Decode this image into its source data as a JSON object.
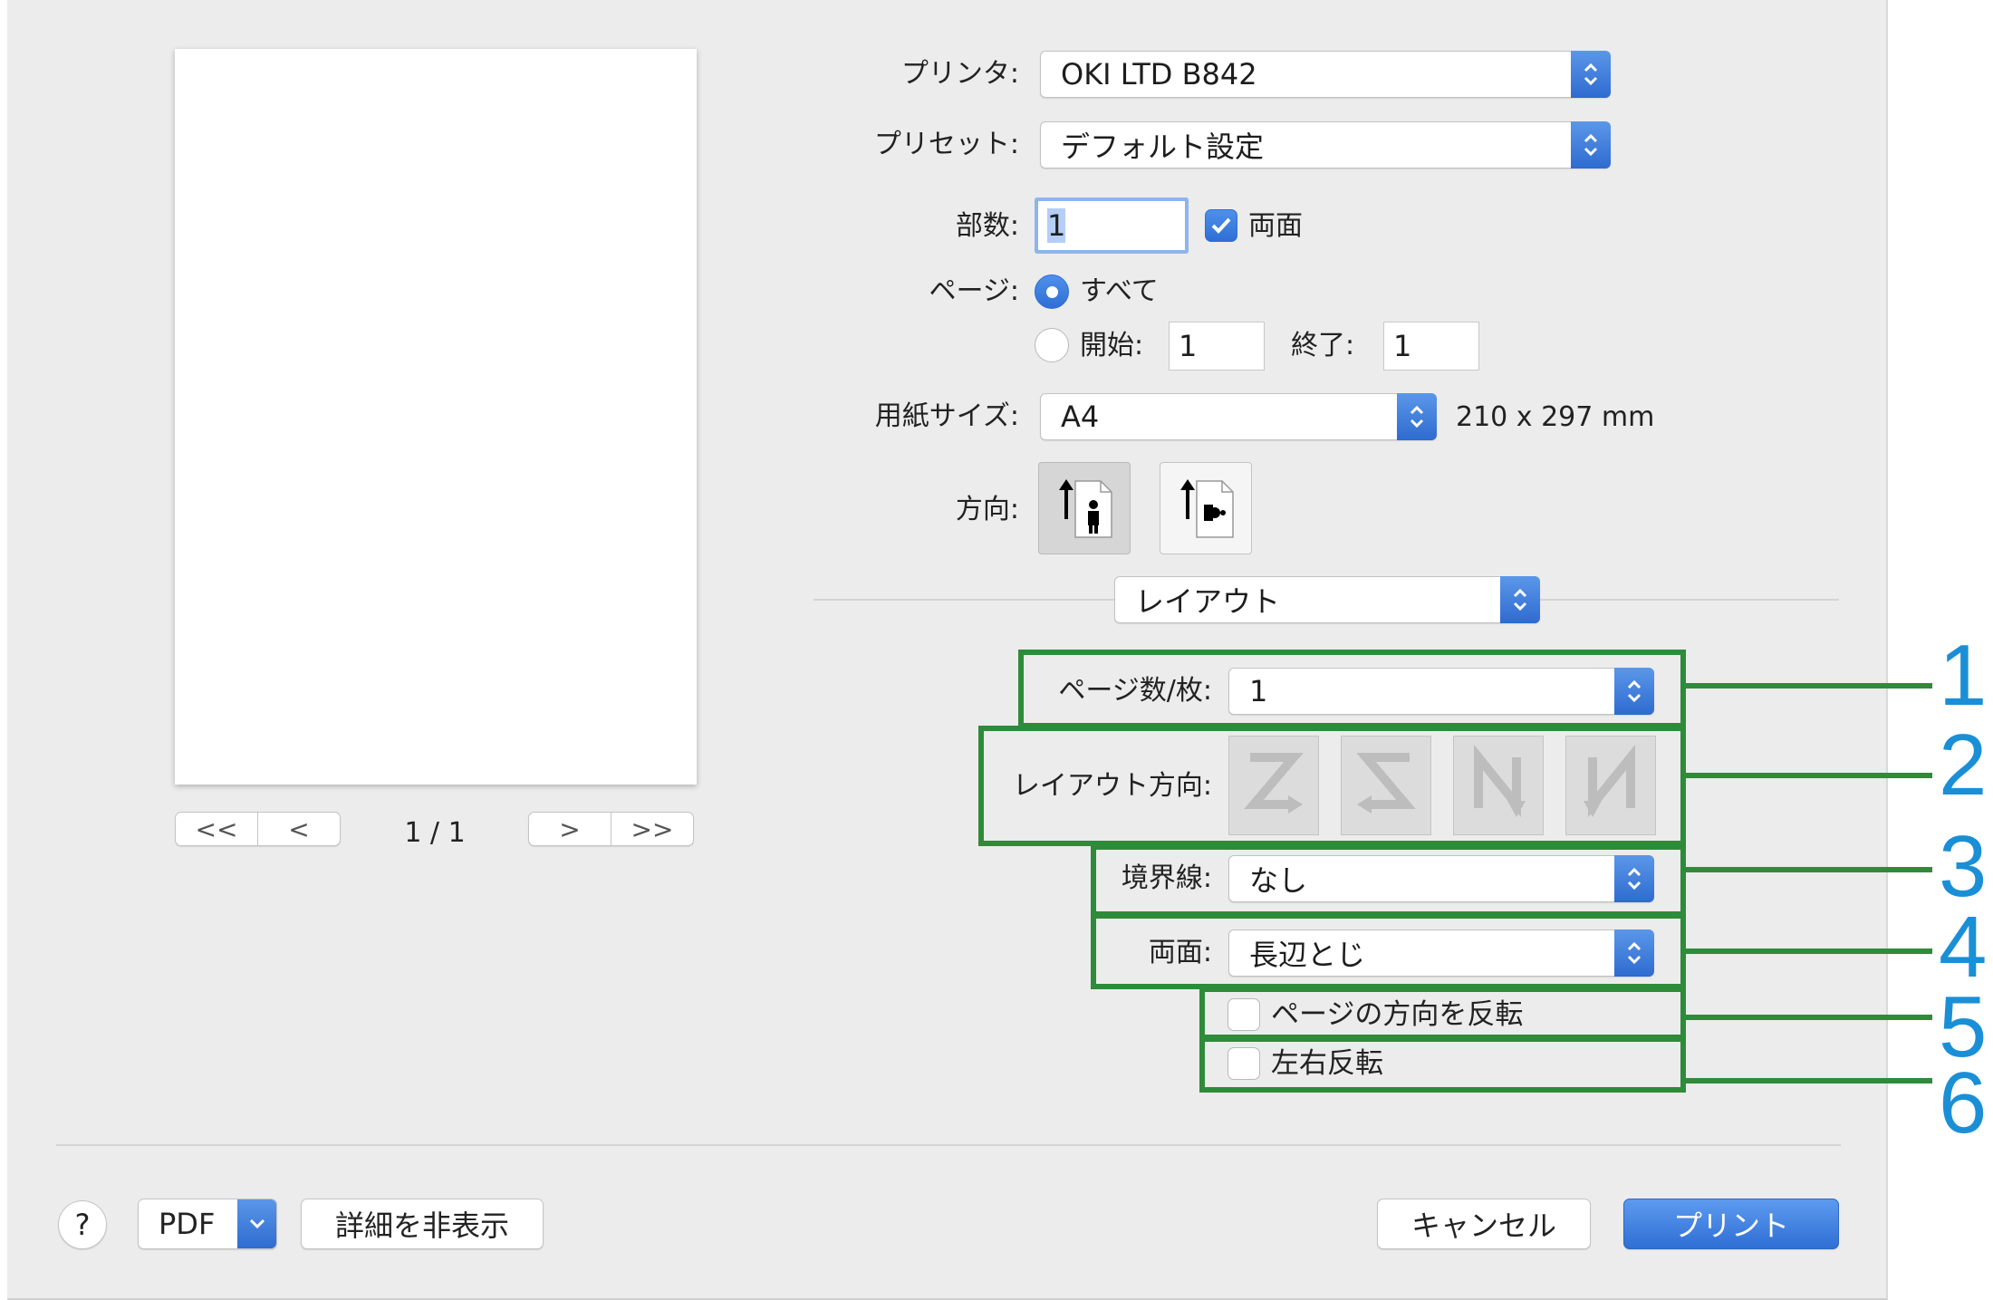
{
  "printer": {
    "label": "プリンタ:",
    "value": "OKI LTD B842"
  },
  "preset": {
    "label": "プリセット:",
    "value": "デフォルト設定"
  },
  "copies": {
    "label": "部数:",
    "value": "1",
    "duplex_label": "両面",
    "duplex_checked": true
  },
  "pages": {
    "label": "ページ:",
    "all_label": "すべて",
    "from_label": "開始:",
    "from_value": "1",
    "to_label": "終了:",
    "to_value": "1"
  },
  "paper": {
    "label": "用紙サイズ:",
    "value": "A4",
    "dimensions": "210 x 297 mm"
  },
  "orientation": {
    "label": "方向:"
  },
  "section": {
    "value": "レイアウト"
  },
  "layout": {
    "pages_per_sheet_label": "ページ数/枚:",
    "pages_per_sheet_value": "1",
    "direction_label": "レイアウト方向:",
    "border_label": "境界線:",
    "border_value": "なし",
    "duplex_label": "両面:",
    "duplex_value": "長辺とじ",
    "reverse_page_label": "ページの方向を反転",
    "flip_horizontal_label": "左右反転"
  },
  "callouts": [
    "1",
    "2",
    "3",
    "4",
    "5",
    "6"
  ],
  "preview": {
    "page_indicator": "1 / 1",
    "first": "<<",
    "prev": "<",
    "next": ">",
    "last": ">>"
  },
  "footer": {
    "help": "?",
    "pdf": "PDF",
    "hide_details": "詳細を非表示",
    "cancel": "キャンセル",
    "print": "プリント"
  },
  "colors": {
    "accent": "#2f6fd6",
    "callout_green": "#2e8b3a",
    "callout_blue": "#1a8fd6"
  }
}
